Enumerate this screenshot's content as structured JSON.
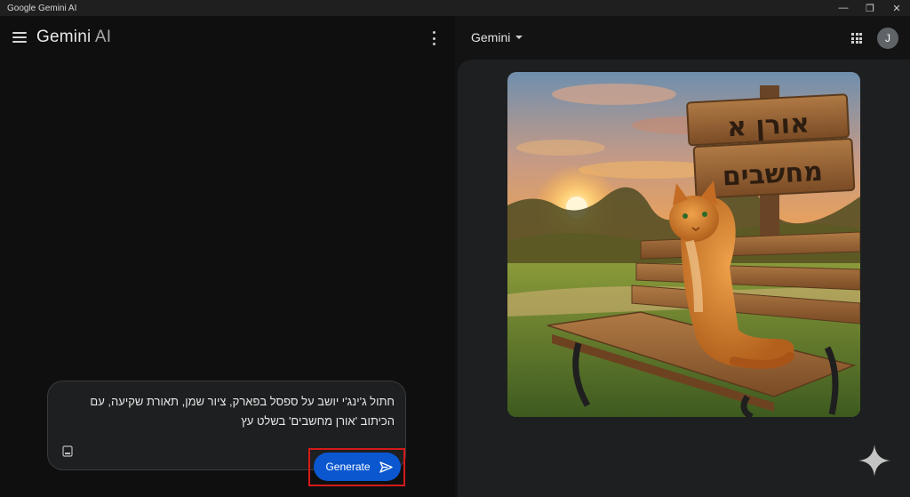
{
  "window": {
    "title": "Google Gemini AI",
    "minimize_glyph": "—",
    "restore_glyph": "❐",
    "close_glyph": "✕"
  },
  "left_header": {
    "brand_main": "Gemini",
    "brand_suffix": " AI"
  },
  "prompt": {
    "text": "חתול ג'ינג'י יושב על ספסל בפארק, ציור שמן, תאורת שקיעה, עם הכיתוב 'אורן מחשבים' בשלט עץ",
    "generate_label": "Generate"
  },
  "right_header": {
    "model_label": "Gemini",
    "avatar_initial": "J"
  },
  "image": {
    "sign_line_1": "אורן א",
    "sign_line_2": "מחשבים"
  },
  "icons": {
    "menu": "menu-icon",
    "more": "more-vert-icon",
    "attach": "image-attach-icon",
    "send": "send-icon",
    "apps": "apps-grid-icon",
    "sparkle": "gemini-sparkle-icon"
  },
  "colors": {
    "accent": "#0b57d0",
    "highlight": "#d41a1a"
  }
}
